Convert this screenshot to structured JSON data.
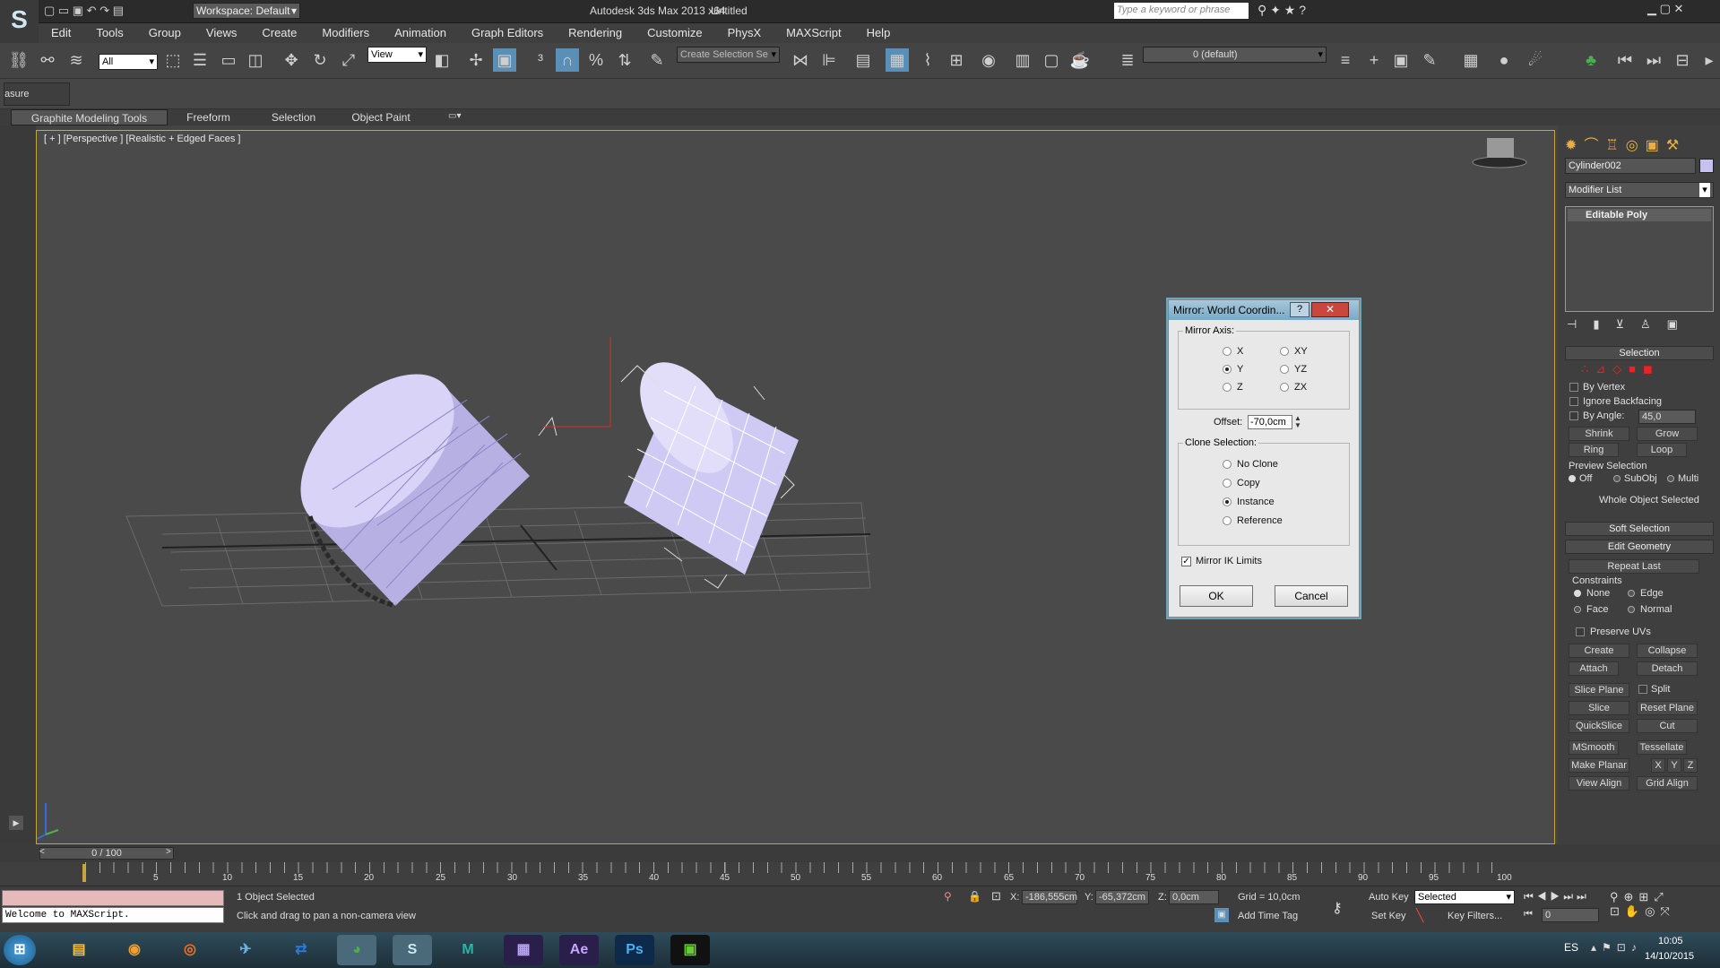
{
  "window": {
    "title": "Autodesk 3ds Max  2013 x64",
    "doc_name": "Untitled",
    "workspace": "Workspace: Default",
    "search_placeholder": "Type a keyword or phrase"
  },
  "menu": [
    "Edit",
    "Tools",
    "Group",
    "Views",
    "Create",
    "Modifiers",
    "Animation",
    "Graph Editors",
    "Rendering",
    "Customize",
    "PhysX",
    "MAXScript",
    "Help"
  ],
  "toolbar": {
    "selection_filter": "All",
    "ref_coord": "View",
    "named_selection": "Create Selection Se",
    "layer": "0 (default)",
    "measure_distance": "asure Distance"
  },
  "ribbon_tabs": [
    "Graphite Modeling Tools",
    "Freeform",
    "Selection",
    "Object Paint"
  ],
  "viewport": {
    "label": "[ + ] [Perspective ] [Realistic + Edged Faces ]"
  },
  "dialog": {
    "title": "Mirror: World Coordin...",
    "help": "?",
    "mirror_axis_label": "Mirror Axis:",
    "axes_left": [
      "X",
      "Y",
      "Z"
    ],
    "axes_right": [
      "XY",
      "YZ",
      "ZX"
    ],
    "selected_axis": "Y",
    "offset_label": "Offset:",
    "offset_value": "-70,0cm",
    "clone_label": "Clone Selection:",
    "clone_options": [
      "No Clone",
      "Copy",
      "Instance",
      "Reference"
    ],
    "selected_clone": "Instance",
    "mirror_ik": "Mirror IK Limits",
    "ok": "OK",
    "cancel": "Cancel"
  },
  "command_panel": {
    "object_name": "Cylinder002",
    "modifier_list": "Modifier List",
    "stack_item": "Editable Poly",
    "selection_header": "Selection",
    "by_vertex": "By Vertex",
    "ignore_backfacing": "Ignore Backfacing",
    "by_angle": "By Angle:",
    "angle_value": "45,0",
    "shrink": "Shrink",
    "grow": "Grow",
    "ring": "Ring",
    "loop": "Loop",
    "preview_selection": "Preview Selection",
    "preview_off": "Off",
    "preview_subobj": "SubObj",
    "preview_multi": "Multi",
    "whole_object": "Whole Object Selected",
    "soft_selection": "Soft Selection",
    "edit_geometry": "Edit Geometry",
    "repeat_last": "Repeat Last",
    "constraints": "Constraints",
    "c_none": "None",
    "c_edge": "Edge",
    "c_face": "Face",
    "c_normal": "Normal",
    "preserve_uvs": "Preserve UVs",
    "create": "Create",
    "collapse": "Collapse",
    "attach": "Attach",
    "detach": "Detach",
    "slice_plane": "Slice Plane",
    "split": "Split",
    "slice": "Slice",
    "reset_plane": "Reset Plane",
    "quickslice": "QuickSlice",
    "cut": "Cut",
    "msmooth": "MSmooth",
    "tessellate": "Tessellate",
    "make_planar": "Make Planar",
    "x": "X",
    "y": "Y",
    "z": "Z",
    "view_align": "View Align",
    "grid_align": "Grid Align"
  },
  "timeline": {
    "frame": "0 / 100",
    "ticks": [
      "5",
      "10",
      "15",
      "20",
      "25",
      "30",
      "35",
      "40",
      "45",
      "50",
      "55",
      "60",
      "65",
      "70",
      "75",
      "80",
      "85",
      "90",
      "95",
      "100"
    ]
  },
  "status": {
    "maxscript": "Welcome to MAXScript.",
    "selected": "1 Object Selected",
    "prompt": "Click and drag to pan a non-camera view",
    "x_label": "X:",
    "x_value": "-186,555cm",
    "y_label": "Y:",
    "y_value": "-65,372cm",
    "z_label": "Z:",
    "z_value": "0,0cm",
    "grid": "Grid = 10,0cm",
    "add_time_tag": "Add Time Tag",
    "auto_key": "Auto Key",
    "set_key": "Set Key",
    "key_mode": "Selected",
    "key_filters": "Key Filters...",
    "frame_field": "0"
  },
  "taskbar": {
    "lang": "ES",
    "time": "10:05",
    "date": "14/10/2015"
  }
}
